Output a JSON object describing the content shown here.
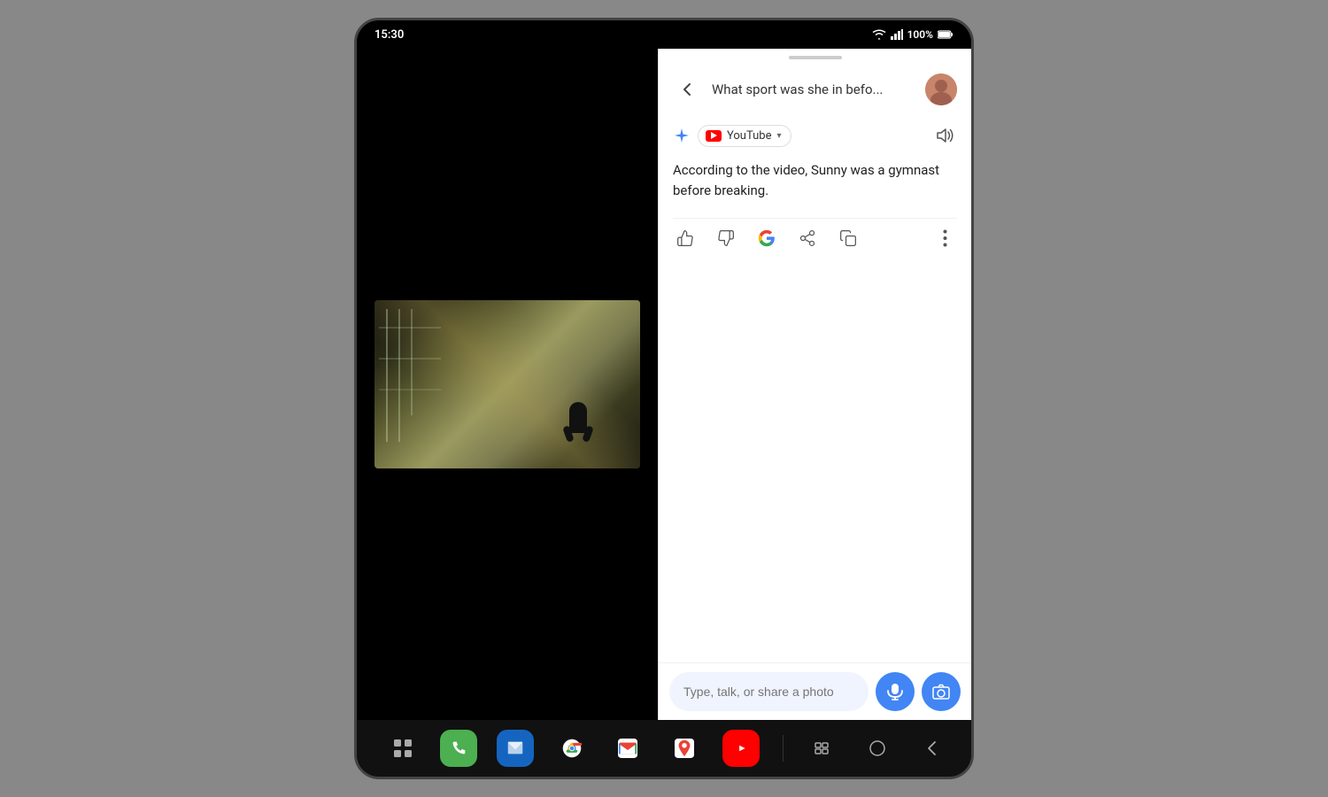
{
  "statusBar": {
    "time": "15:30",
    "battery": "100%",
    "batteryFull": true
  },
  "header": {
    "title": "What sport was she in befo...",
    "backLabel": "←"
  },
  "source": {
    "name": "YouTube",
    "pillLabel": "YouTube",
    "chevron": "▾"
  },
  "answer": {
    "text": "According to the video, Sunny was a gymnast before breaking."
  },
  "actions": {
    "thumbUp": "👍",
    "thumbDown": "👎",
    "share": "⬆",
    "copy": "⧉",
    "more": "⋮"
  },
  "inputBar": {
    "placeholder": "Type, talk, or share a photo"
  },
  "bottomApps": [
    {
      "name": "Grid",
      "icon": "grid"
    },
    {
      "name": "Phone",
      "icon": "phone"
    },
    {
      "name": "Messages",
      "icon": "messages"
    },
    {
      "name": "Chrome",
      "icon": "chrome"
    },
    {
      "name": "Gmail",
      "icon": "gmail"
    },
    {
      "name": "Maps",
      "icon": "maps"
    },
    {
      "name": "YouTube",
      "icon": "youtube"
    }
  ],
  "systemNav": [
    {
      "name": "Recents",
      "icon": "|||"
    },
    {
      "name": "Home",
      "icon": "○"
    },
    {
      "name": "Back",
      "icon": "‹"
    }
  ]
}
